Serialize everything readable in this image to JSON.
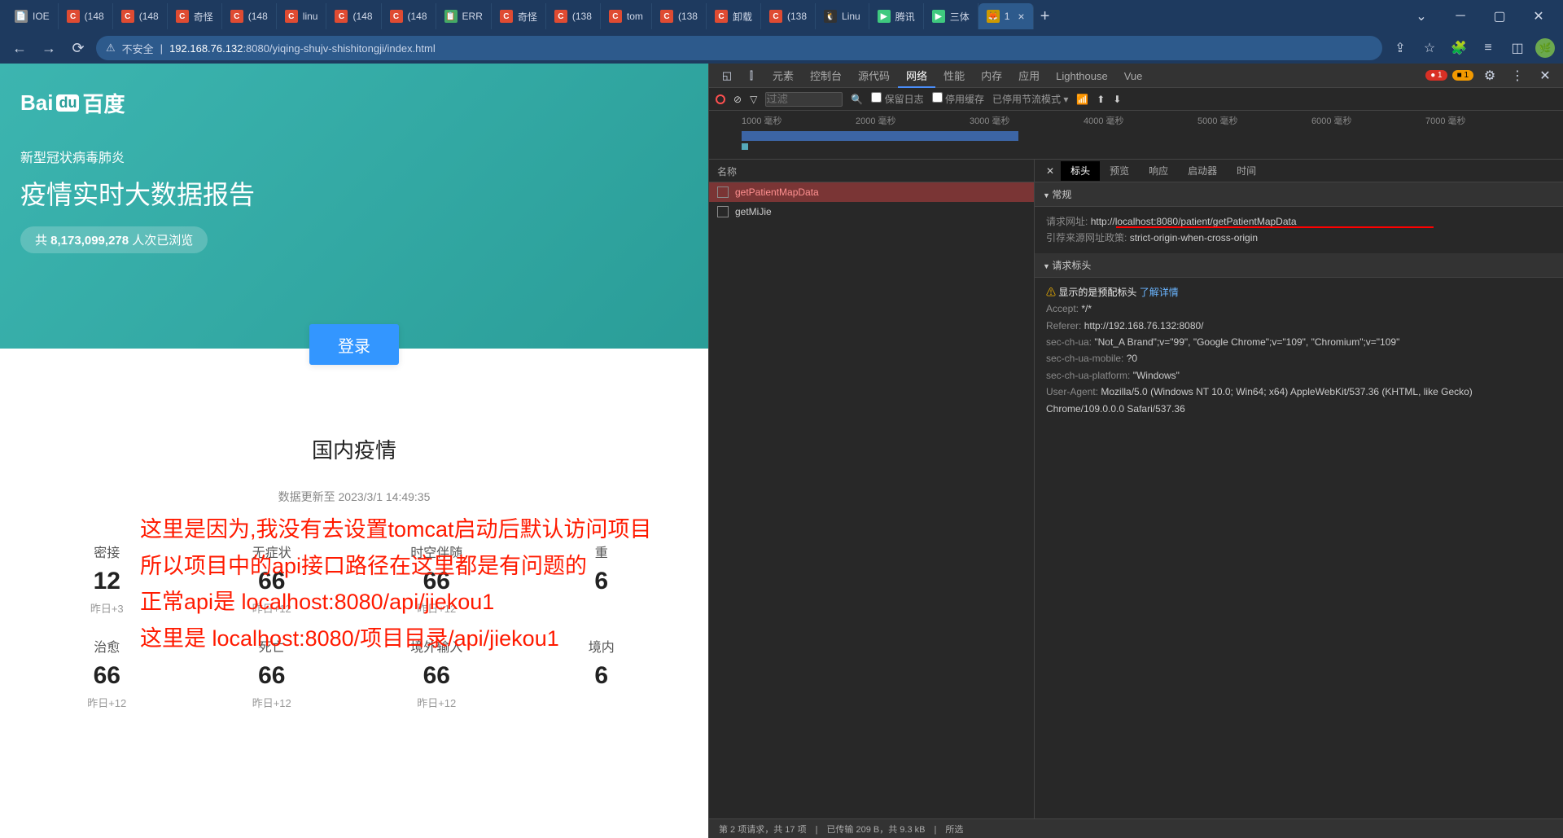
{
  "tabs": [
    {
      "icon": "📄",
      "color": "#888",
      "label": "IOE"
    },
    {
      "icon": "C",
      "color": "#df4b32",
      "label": "(148"
    },
    {
      "icon": "C",
      "color": "#df4b32",
      "label": "(148"
    },
    {
      "icon": "C",
      "color": "#df4b32",
      "label": "奇怪"
    },
    {
      "icon": "C",
      "color": "#df4b32",
      "label": "(148"
    },
    {
      "icon": "C",
      "color": "#df4b32",
      "label": "linu"
    },
    {
      "icon": "C",
      "color": "#df4b32",
      "label": "(148"
    },
    {
      "icon": "C",
      "color": "#df4b32",
      "label": "(148"
    },
    {
      "icon": "📋",
      "color": "#4a6",
      "label": "ERR"
    },
    {
      "icon": "C",
      "color": "#df4b32",
      "label": "奇怪"
    },
    {
      "icon": "C",
      "color": "#df4b32",
      "label": "(138"
    },
    {
      "icon": "C",
      "color": "#df4b32",
      "label": "tom"
    },
    {
      "icon": "C",
      "color": "#df4b32",
      "label": "(138"
    },
    {
      "icon": "C",
      "color": "#df4b32",
      "label": "卸载"
    },
    {
      "icon": "C",
      "color": "#df4b32",
      "label": "(138"
    },
    {
      "icon": "🐧",
      "color": "#333",
      "label": "Linu"
    },
    {
      "icon": "▶",
      "color": "#3fc97f",
      "label": "腾讯"
    },
    {
      "icon": "▶",
      "color": "#3fc97f",
      "label": "三体"
    },
    {
      "icon": "🦊",
      "color": "#c90",
      "label": "1",
      "active": true
    }
  ],
  "url": {
    "insecure": "不安全",
    "ip": "192.168.76.132",
    "port": ":8080",
    "path": "/yiqing-shujv-shishitongji/index.html"
  },
  "page": {
    "logo": "Bai",
    "logo2": "百度",
    "paw": "du",
    "subtitle": "新型冠状病毒肺炎",
    "title": "疫情实时大数据报告",
    "chip_prefix": "共 ",
    "chip_num": "8,173,099,278",
    "chip_suffix": " 人次已浏览",
    "login": "登录",
    "section_title": "国内疫情",
    "update": "数据更新至 2023/3/1 14:49:35",
    "stats": [
      {
        "label": "密接",
        "val": "12",
        "delta": "昨日+3"
      },
      {
        "label": "无症状",
        "val": "66",
        "delta": "昨日+12"
      },
      {
        "label": "时空伴随",
        "val": "66",
        "delta": "昨日+12"
      },
      {
        "label": "重",
        "val": "6",
        "delta": ""
      }
    ],
    "stats2": [
      {
        "label": "治愈",
        "val": "66",
        "delta": "昨日+12"
      },
      {
        "label": "死亡",
        "val": "66",
        "delta": "昨日+12"
      },
      {
        "label": "境外输入",
        "val": "66",
        "delta": "昨日+12"
      },
      {
        "label": "境内",
        "val": "6",
        "delta": ""
      }
    ]
  },
  "overlay": {
    "l1": "这里是因为,我没有去设置tomcat启动后默认访问项目",
    "l2": "所以项目中的api接口路径在这里都是有问题的",
    "l3": "正常api是  localhost:8080/api/jiekou1",
    "l4": "这里是  localhost:8080/项目目录/api/jiekou1"
  },
  "dt": {
    "tabs": [
      "元素",
      "控制台",
      "源代码",
      "网络",
      "性能",
      "内存",
      "应用",
      "Lighthouse",
      "Vue"
    ],
    "active_tab": "网络",
    "err_count": "1",
    "warn_count": "1",
    "filter_placeholder": "过滤",
    "保留日志": "保留日志",
    "停用缓存": "停用缓存",
    "已停用节流模式": "已停用节流模式",
    "tl": [
      "1000 毫秒",
      "2000 毫秒",
      "3000 毫秒",
      "4000 毫秒",
      "5000 毫秒",
      "6000 毫秒",
      "7000 毫秒"
    ],
    "name_col": "名称",
    "reqs": [
      {
        "name": "getPatientMapData",
        "sel": true
      },
      {
        "name": "getMiJie",
        "sel": false
      }
    ],
    "detail_tabs": [
      "标头",
      "预览",
      "响应",
      "启动器",
      "时间"
    ],
    "detail_active": "标头",
    "常规": "常规",
    "req_url_k": "请求网址:",
    "req_url_v": "http://localhost:8080/patient/getPatientMapData",
    "ref_pol_k": "引荐来源网址政策:",
    "ref_pol_v": "strict-origin-when-cross-origin",
    "请求标头": "请求标头",
    "warn_text": "显示的是预配标头",
    "了解详情": "了解详情",
    "h": [
      {
        "k": "Accept:",
        "v": "*/*"
      },
      {
        "k": "Referer:",
        "v": "http://192.168.76.132:8080/"
      },
      {
        "k": "sec-ch-ua:",
        "v": "\"Not_A Brand\";v=\"99\", \"Google Chrome\";v=\"109\", \"Chromium\";v=\"109\""
      },
      {
        "k": "sec-ch-ua-mobile:",
        "v": "?0"
      },
      {
        "k": "sec-ch-ua-platform:",
        "v": "\"Windows\""
      },
      {
        "k": "User-Agent:",
        "v": "Mozilla/5.0 (Windows NT 10.0; Win64; x64) AppleWebKit/537.36 (KHTML, like Gecko) Chrome/109.0.0.0 Safari/537.36"
      }
    ],
    "status": "第 2 项请求，共 17 项　|　已传输 209 B，共 9.3 kB　|　所选"
  }
}
